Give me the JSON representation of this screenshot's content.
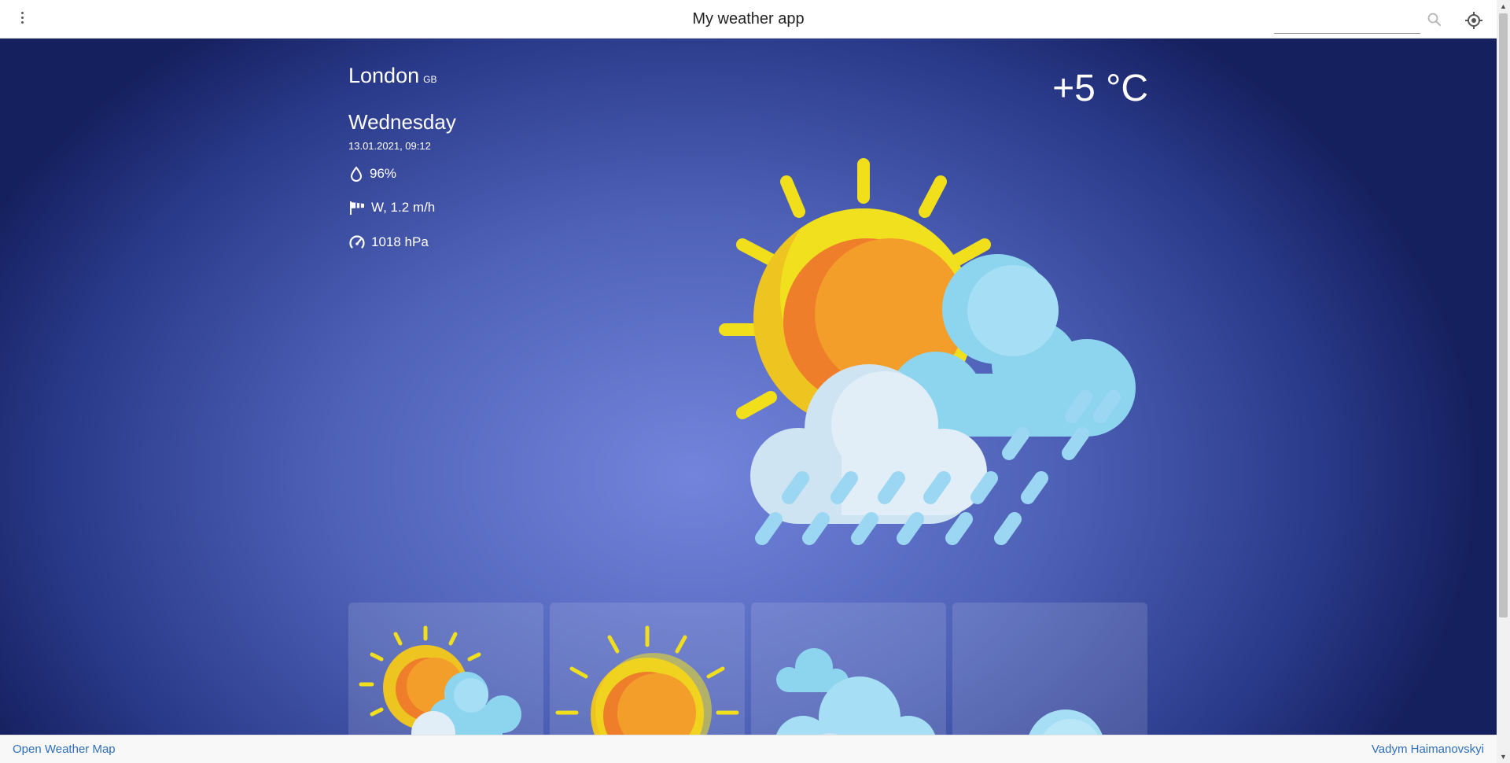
{
  "header": {
    "title": "My weather app",
    "search_placeholder": "",
    "menu_icon": "more-vert-icon",
    "search_icon": "search-icon",
    "location_icon": "my-location-icon"
  },
  "current": {
    "city": "London",
    "country": "GB",
    "temperature": "+5 °C",
    "weekday": "Wednesday",
    "datetime": "13.01.2021, 09:12",
    "humidity": "96%",
    "wind": "W, 1.2 m/h",
    "pressure": "1018 hPa",
    "icon": "sun-cloud-rain-icon"
  },
  "forecast": [
    {
      "icon": "sun-behind-cloud-icon"
    },
    {
      "icon": "sun-icon"
    },
    {
      "icon": "clouds-icon"
    },
    {
      "icon": "cloud-icon"
    }
  ],
  "footer": {
    "left_link": "Open Weather Map",
    "right_link": "Vadym Haimanovskyi"
  },
  "colors": {
    "sun_rays": "#f2df1c",
    "sun_outer": "#eec420",
    "sun_inner": "#f09b2a",
    "cloud_back": "#8dd4ee",
    "cloud_front": "#e2eef7",
    "rain": "#9bd7f2",
    "link": "#2f6fbb"
  }
}
